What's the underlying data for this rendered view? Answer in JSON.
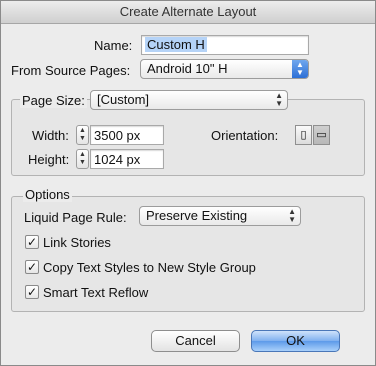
{
  "dialog": {
    "title": "Create Alternate Layout"
  },
  "name": {
    "label": "Name:",
    "value": "Custom H"
  },
  "source_pages": {
    "label": "From Source Pages:",
    "value": "Android 10\" H"
  },
  "page_size": {
    "label": "Page Size:",
    "value": "[Custom]",
    "width_label": "Width:",
    "width_value": "3500 px",
    "height_label": "Height:",
    "height_value": "1024 px",
    "orientation_label": "Orientation:"
  },
  "options": {
    "legend": "Options",
    "liquid_rule_label": "Liquid Page Rule:",
    "liquid_rule_value": "Preserve Existing",
    "checkboxes": [
      {
        "label": "Link Stories",
        "checked": true
      },
      {
        "label": "Copy Text Styles to New Style Group",
        "checked": true
      },
      {
        "label": "Smart Text Reflow",
        "checked": true
      }
    ]
  },
  "buttons": {
    "cancel": "Cancel",
    "ok": "OK"
  }
}
